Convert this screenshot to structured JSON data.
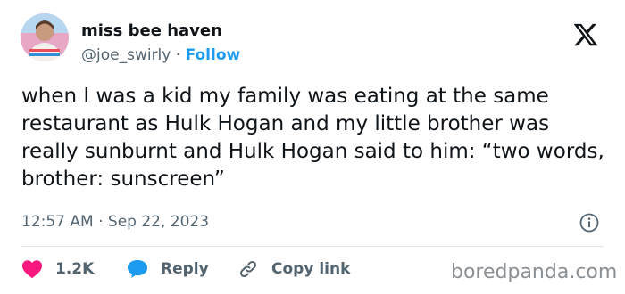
{
  "user": {
    "name": "miss bee haven",
    "handle": "@joe_swirly",
    "separator": " · ",
    "follow_label": "Follow",
    "avatar_icon": "avatar-photo"
  },
  "brand": {
    "logo_icon": "x-logo-icon"
  },
  "tweet": {
    "text": "when I was a kid my family was eating at the same restaurant as Hulk Hogan and my little brother was really sunburnt and Hulk Hogan said to him: “two words, brother: sunscreen”",
    "timestamp": "12:57 AM · Sep 22, 2023"
  },
  "actions": {
    "like_count": "1.2K",
    "reply_label": "Reply",
    "copy_link_label": "Copy link"
  },
  "colors": {
    "like": "#f91880",
    "reply": "#1d9bf0",
    "link": "#1d9bf0",
    "muted": "#536471"
  },
  "watermark": "boredpanda.com"
}
